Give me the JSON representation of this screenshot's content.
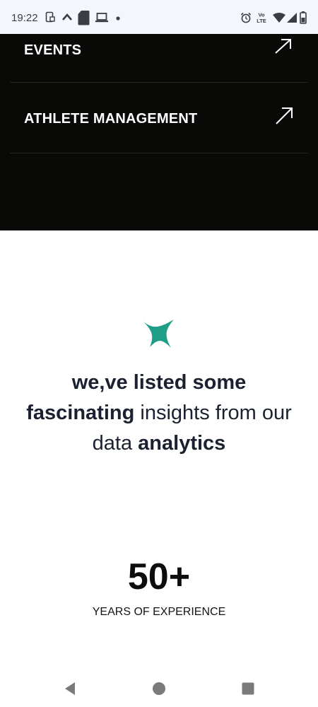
{
  "status_bar": {
    "time": "19:22",
    "left_icons": [
      "screenshot-icon",
      "chevron-up-icon",
      "sd-card-icon",
      "laptop-icon",
      "dot-icon"
    ],
    "right_icons": [
      "alarm-icon",
      "volte-icon",
      "wifi-icon",
      "signal-icon",
      "battery-icon"
    ],
    "volte_text": "Vo LTE"
  },
  "menu": {
    "items": [
      {
        "label": "EVENTS",
        "icon": "arrow-up-right-icon"
      },
      {
        "label": "ATHLETE MANAGEMENT",
        "icon": "arrow-up-right-icon"
      }
    ]
  },
  "insights": {
    "icon": "sparkle-star-icon",
    "accent_color": "#1e9e86",
    "line1": "we,ve listed some",
    "line2_bold": "fascinating",
    "line2_rest": " insights from our",
    "line3_normal": "data ",
    "line3_bold": "analytics"
  },
  "stat": {
    "value": "50+",
    "label": "YEARS OF EXPERIENCE"
  },
  "nav_bar": {
    "buttons": [
      "back-icon",
      "home-icon",
      "recents-icon"
    ]
  }
}
